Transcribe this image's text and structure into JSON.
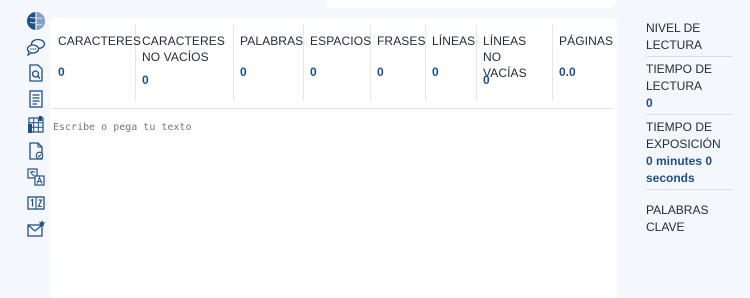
{
  "rail": {
    "icons": [
      "brain-icon",
      "chat-bubbles-icon",
      "document-search-icon",
      "document-lines-icon",
      "grid-chart-icon",
      "document-check-icon",
      "translate-icon",
      "counter-icon",
      "mail-star-icon"
    ]
  },
  "stats": [
    {
      "label": "CARACTERES",
      "value": "0"
    },
    {
      "label": "CARACTERES NO VACÍOS",
      "value": "0"
    },
    {
      "label": "PALABRAS",
      "value": "0"
    },
    {
      "label": "ESPACIOS",
      "value": "0"
    },
    {
      "label": "FRASES",
      "value": "0"
    },
    {
      "label": "LÍNEAS",
      "value": "0"
    },
    {
      "label": "LÍNEAS NO VACÍAS",
      "value": "0"
    },
    {
      "label": "PÁGINAS",
      "value": "0.0"
    }
  ],
  "editor": {
    "placeholder": "Escribe o pega tu texto"
  },
  "side": {
    "reading_level": {
      "label": "NIVEL DE LECTURA"
    },
    "reading_time": {
      "label": "TIEMPO DE LECTURA",
      "value": "0"
    },
    "speaking_time": {
      "label": "TIEMPO DE EXPOSICIÓN",
      "value": "0 minutes 0 seconds"
    },
    "keywords": {
      "label": "PALABRAS CLAVE"
    }
  },
  "colors": {
    "accent": "#1f4f85",
    "background": "#f4f8fc",
    "panel": "#ffffff"
  }
}
